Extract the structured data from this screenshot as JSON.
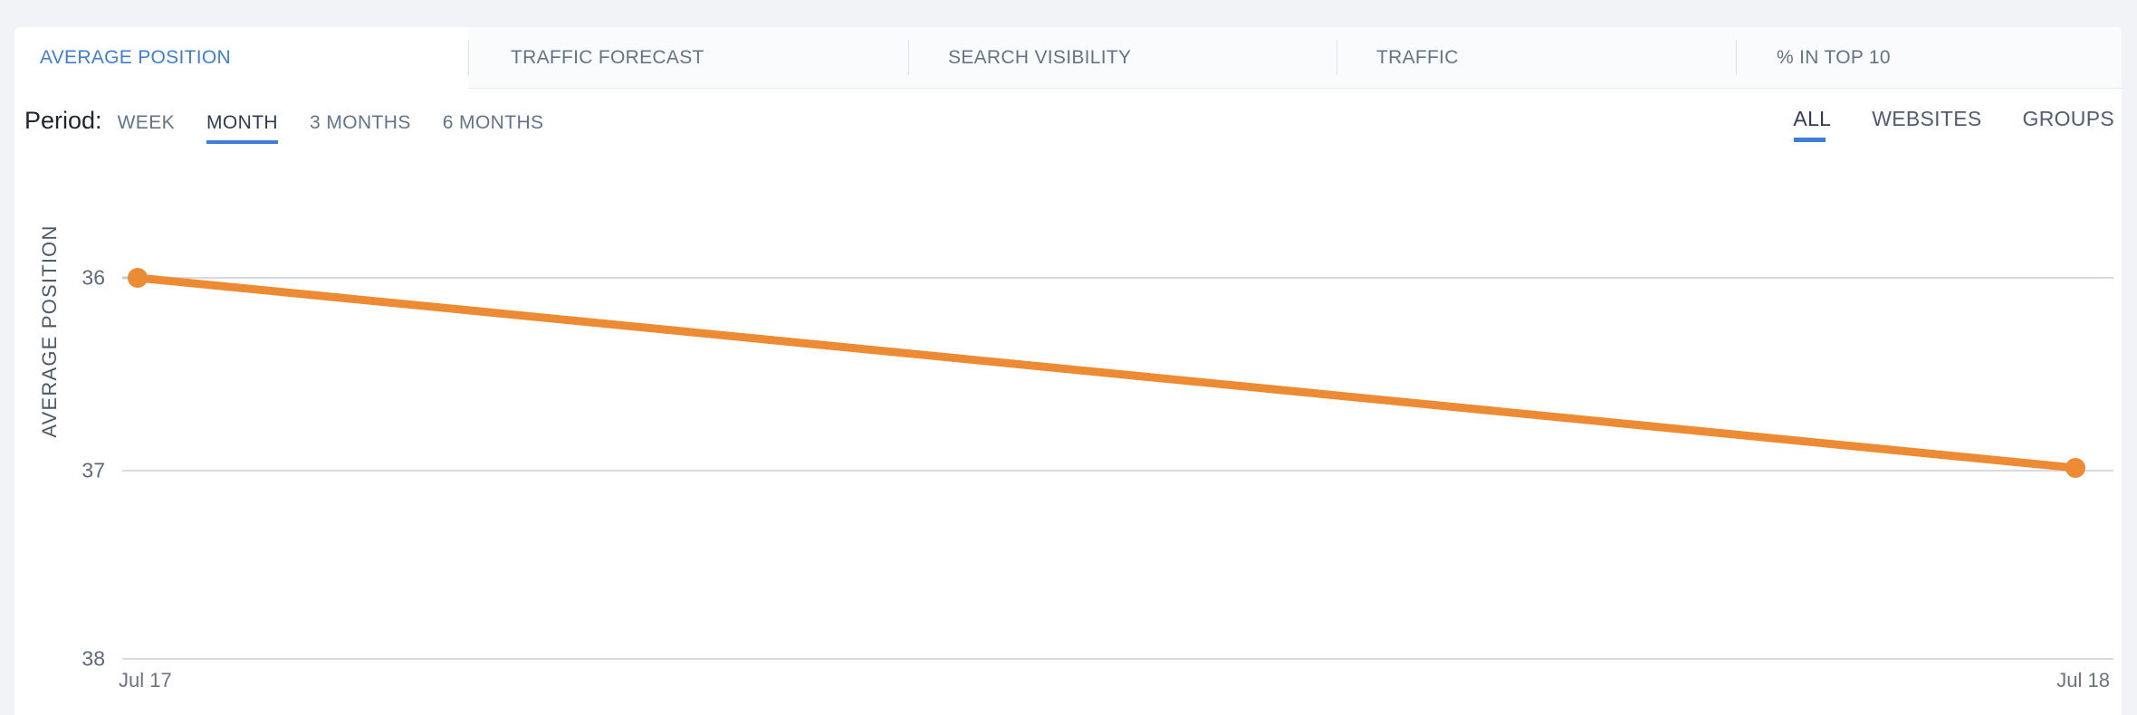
{
  "card": {
    "background": "#ffffff",
    "page_background": "#f1f3f6"
  },
  "tabs": [
    {
      "label": "AVERAGE POSITION",
      "active": true
    },
    {
      "label": "TRAFFIC FORECAST",
      "active": false
    },
    {
      "label": "SEARCH VISIBILITY",
      "active": false
    },
    {
      "label": "TRAFFIC",
      "active": false
    },
    {
      "label": "% IN TOP 10",
      "active": false
    }
  ],
  "controls": {
    "period_label": "Period:",
    "period_options": [
      {
        "label": "WEEK",
        "active": false
      },
      {
        "label": "MONTH",
        "active": true
      },
      {
        "label": "3 MONTHS",
        "active": false
      },
      {
        "label": "6 MONTHS",
        "active": false
      }
    ],
    "scope_options": [
      {
        "label": "ALL",
        "active": true
      },
      {
        "label": "WEBSITES",
        "active": false
      },
      {
        "label": "GROUPS",
        "active": false
      }
    ]
  },
  "colors": {
    "accent": "#3d7fd6",
    "series": "#ec8b33",
    "gridline": "#d7d9e3",
    "tab_inactive_bg": "#fafbfc",
    "tab_text": "#62748a"
  },
  "chart_data": {
    "type": "line",
    "title": "",
    "xlabel": "",
    "ylabel": "AVERAGE POSITION",
    "x": [
      "Jul 17",
      "Jul 18"
    ],
    "categories": [
      "Jul 17",
      "Jul 18"
    ],
    "series": [
      {
        "name": "Average position",
        "values": [
          36,
          37
        ],
        "color": "#ec8b33"
      }
    ],
    "yticks": [
      36,
      37,
      38
    ],
    "ylim": [
      36,
      38
    ],
    "y_inverted": true,
    "grid": true,
    "legend": false,
    "markers": true
  }
}
